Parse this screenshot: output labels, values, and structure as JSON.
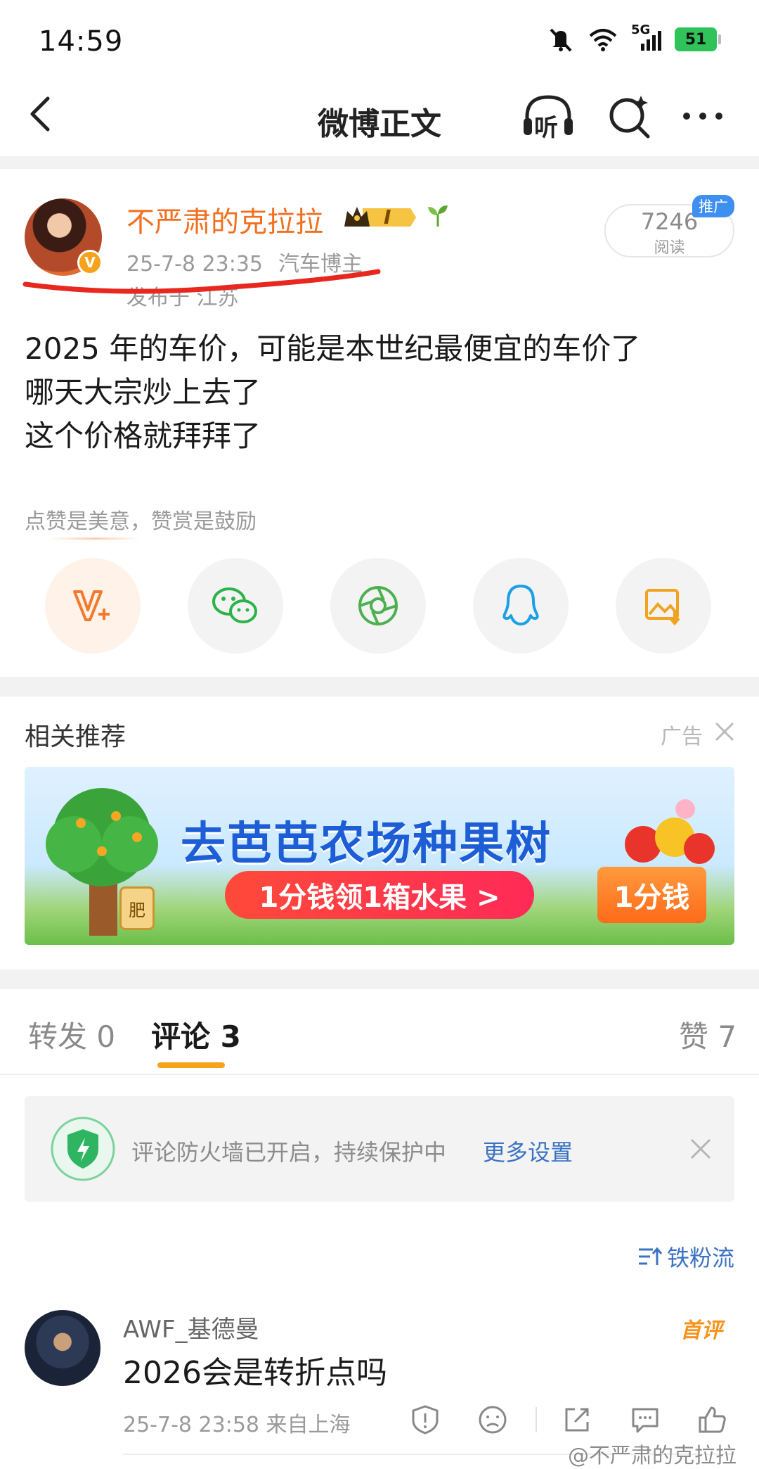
{
  "status": {
    "time": "14:59",
    "network": "5G",
    "battery": "51"
  },
  "nav": {
    "title": "微博正文",
    "listen_label": "听"
  },
  "post": {
    "author": "不严肃的克拉拉",
    "level": "I",
    "verified": "V",
    "timestamp": "25-7-8 23:35",
    "tag": "汽车博主",
    "location": "发布于 江苏",
    "read_count": "7246",
    "read_label": "阅读",
    "promo_tag": "推广",
    "lines": [
      "2025 年的车价，可能是本世纪最便宜的车价了",
      "哪天大宗炒上去了",
      "这个价格就拜拜了"
    ],
    "reward_hint": "点赞是美意，赞赏是鼓励",
    "share_buttons": [
      "reward-v-icon",
      "wechat-icon",
      "moments-icon",
      "qq-icon",
      "save-image-icon"
    ]
  },
  "related": {
    "title": "相关推荐",
    "ad_label": "广告",
    "banner": {
      "headline": "去芭芭农场种果树",
      "cta": "1分钱领1箱水果 >",
      "price": "1分钱",
      "fertilizer": "肥"
    }
  },
  "tabs": {
    "repost": "转发 0",
    "comments": "评论 3",
    "likes": "赞 7"
  },
  "firewall": {
    "text": "评论防火墙已开启，持续保护中",
    "link": "更多设置"
  },
  "sort": {
    "label": "铁粉流"
  },
  "comments": [
    {
      "name": "AWF_基德曼",
      "badge": "首评",
      "text": "2026会是转折点吗",
      "meta": "25-7-8 23:58 来自上海"
    }
  ],
  "watermark": "@不严肃的克拉拉",
  "colors": {
    "accent": "#f7a21b",
    "username": "#f36f20",
    "link": "#3b73c4"
  }
}
